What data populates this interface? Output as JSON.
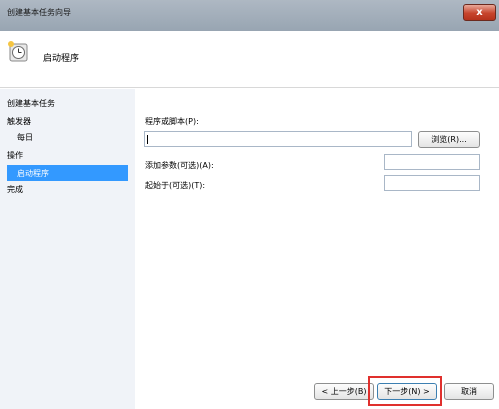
{
  "window": {
    "title": "创建基本任务向导",
    "close_symbol": "x"
  },
  "header": {
    "title": "启动程序",
    "icon": "scheduled-task-clock-icon"
  },
  "nav": [
    {
      "label": "创建基本任务"
    },
    {
      "label": "触发器"
    },
    {
      "label": "每日"
    },
    {
      "label": "操作"
    },
    {
      "label": "启动程序",
      "selected": true
    },
    {
      "label": "完成"
    }
  ],
  "form": {
    "program_label": "程序或脚本(P):",
    "program_value": "",
    "browse_label": "浏览(R)...",
    "args_label": "添加参数(可选)(A):",
    "args_value": "",
    "startin_label": "起始于(可选)(T):",
    "startin_value": ""
  },
  "footer": {
    "back_label": "< 上一步(B)",
    "next_label": "下一步(N) >",
    "cancel_label": "取消"
  },
  "colors": {
    "selected": "#3399ff",
    "highlight": "#e0302d",
    "left_pane": "#f0f3f8"
  }
}
